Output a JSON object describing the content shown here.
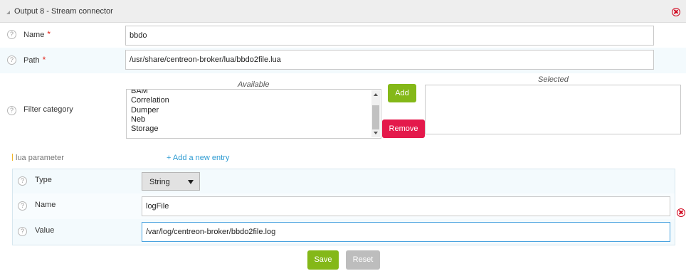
{
  "panel": {
    "title": "Output 8 - Stream connector"
  },
  "fields": {
    "name": {
      "label": "Name",
      "required_mark": "*",
      "value": "bbdo"
    },
    "path": {
      "label": "Path",
      "required_mark": "*",
      "value": "/usr/share/centreon-broker/lua/bbdo2file.lua"
    },
    "filter_category": {
      "label": "Filter category",
      "available_caption": "Available",
      "selected_caption": "Selected",
      "available_items": [
        "BAM",
        "Correlation",
        "Dumper",
        "Neb",
        "Storage"
      ],
      "selected_items": [],
      "add_label": "Add",
      "remove_label": "Remove"
    }
  },
  "lua_parameter": {
    "section_label": "lua parameter",
    "add_entry_label": "+ Add a new entry",
    "entry": {
      "type": {
        "label": "Type",
        "value": "String"
      },
      "name": {
        "label": "Name",
        "value": "logFile"
      },
      "value": {
        "label": "Value",
        "value": "/var/log/centreon-broker/bbdo2file.log"
      }
    }
  },
  "help_glyph": "?",
  "actions": {
    "save_label": "Save",
    "reset_label": "Reset"
  },
  "colors": {
    "accent_green": "#84b818",
    "danger_red": "#e4194b",
    "link_blue": "#2d9bd2",
    "required_red": "#e2231a"
  }
}
